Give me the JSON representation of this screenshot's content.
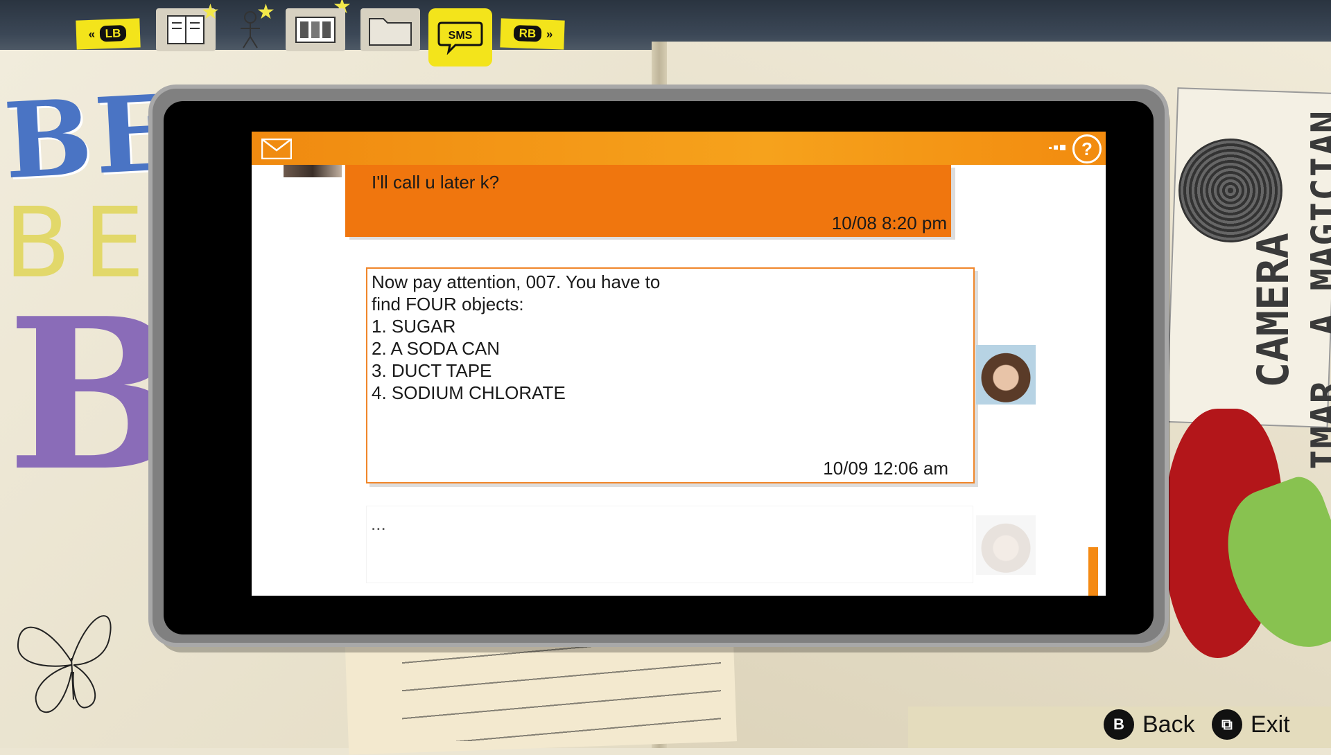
{
  "tabs": {
    "lb": "LB",
    "rb": "RB",
    "sms": "SMS",
    "journal_icon": "journal-icon",
    "people_icon": "people-icon",
    "photos_icon": "photos-icon",
    "documents_icon": "folder-icon"
  },
  "background_text": {
    "be1": "BE",
    "be2": "BE",
    "be3": "BI",
    "camera": "CAMERA",
    "magician": "IMAR, A MAGICIAN"
  },
  "phone": {
    "header_icon": "mail-icon",
    "help": "?",
    "messages": [
      {
        "text": "I'll call u later k?",
        "timestamp": "10/08  8:20 pm"
      },
      {
        "lines": [
          "Now pay attention, 007. You have to",
          "find FOUR objects:",
          "1. SUGAR",
          "2. A SODA CAN",
          "3. DUCT TAPE",
          "4. SODIUM CHLORATE"
        ],
        "timestamp": "10/09  12:06 am"
      },
      {
        "text": "..."
      }
    ]
  },
  "footer": {
    "back_key": "B",
    "back_label": "Back",
    "exit_key": "⧉",
    "exit_label": "Exit"
  },
  "colors": {
    "accent": "#f0760e",
    "tab_yellow": "#f3e41b"
  }
}
